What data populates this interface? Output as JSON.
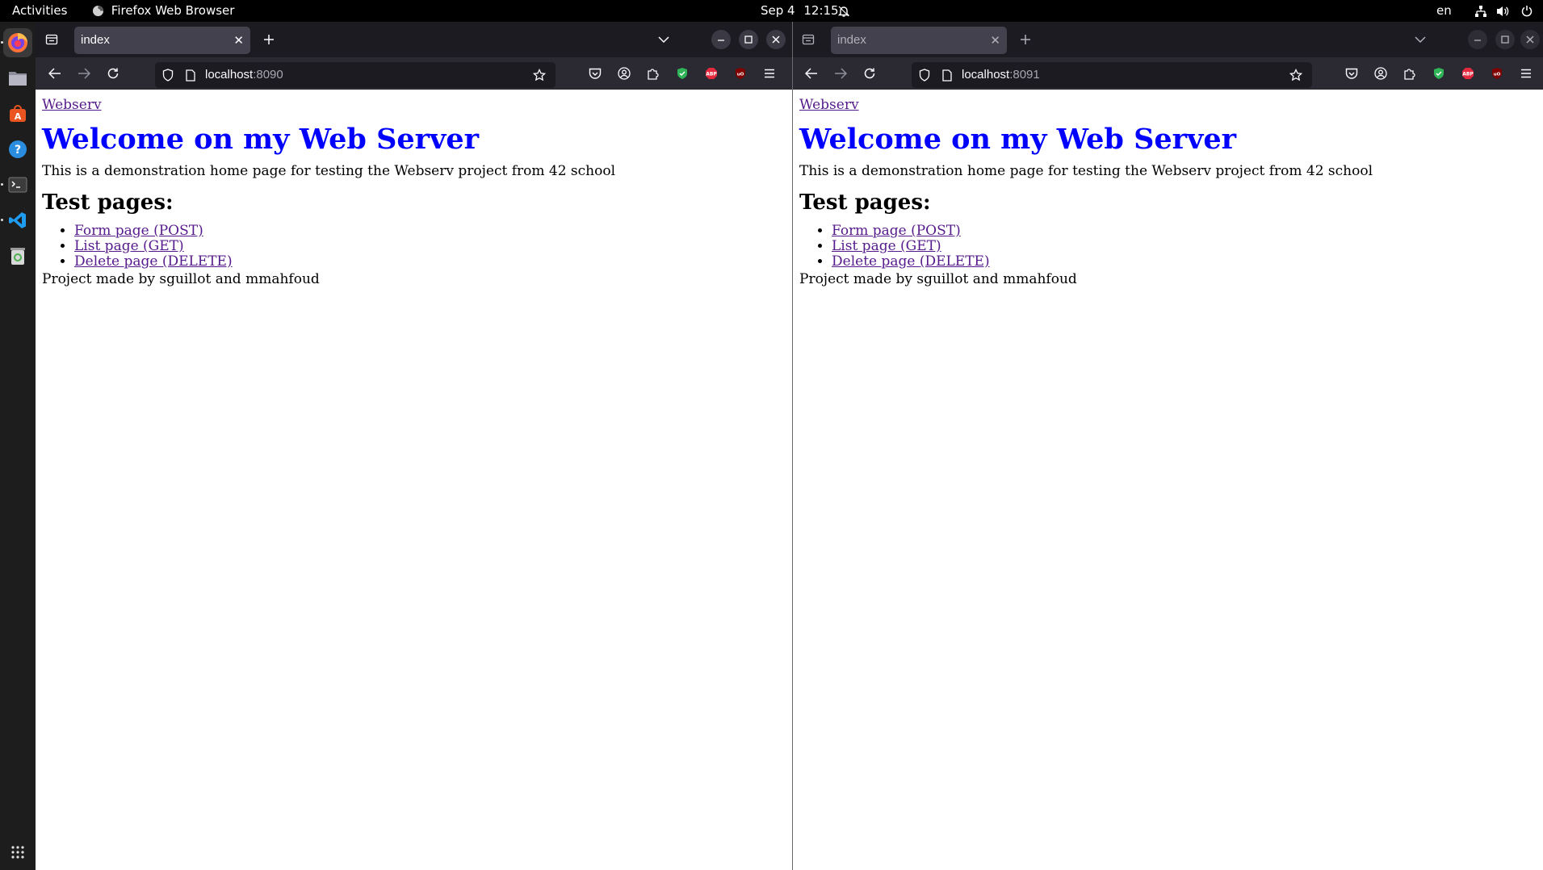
{
  "topbar": {
    "activities": "Activities",
    "app_name": "Firefox Web Browser",
    "date": "Sep 4",
    "time": "12:15",
    "language": "en"
  },
  "dock": {
    "apps": [
      "firefox-icon",
      "files-icon",
      "app-center-icon",
      "help-icon",
      "terminal-icon",
      "vscode-icon",
      "trash-icon"
    ],
    "show_apps": "show-applications-icon"
  },
  "colors": {
    "heading": "#0000ff",
    "visited_link": "#551a8b",
    "tab_bg": "#42414d",
    "toolbar_bg": "#2b2a33",
    "tabstrip_bg": "#1c1b22"
  },
  "windows": [
    {
      "tab_title": "index",
      "url_host": "localhost",
      "url_port": ":8090",
      "page": {
        "brand_link": "Webserv",
        "heading": "Welcome on my Web Server",
        "description": "This is a demonstration home page for testing the Webserv project from 42 school",
        "subheading": "Test pages:",
        "links": [
          "Form page (POST)",
          "List page (GET)",
          "Delete page (DELETE)"
        ],
        "footer": "Project made by sguillot and mmahfoud"
      }
    },
    {
      "tab_title": "index",
      "url_host": "localhost",
      "url_port": ":8091",
      "page": {
        "brand_link": "Webserv",
        "heading": "Welcome on my Web Server",
        "description": "This is a demonstration home page for testing the Webserv project from 42 school",
        "subheading": "Test pages:",
        "links": [
          "Form page (POST)",
          "List page (GET)",
          "Delete page (DELETE)"
        ],
        "footer": "Project made by sguillot and mmahfoud"
      }
    }
  ]
}
